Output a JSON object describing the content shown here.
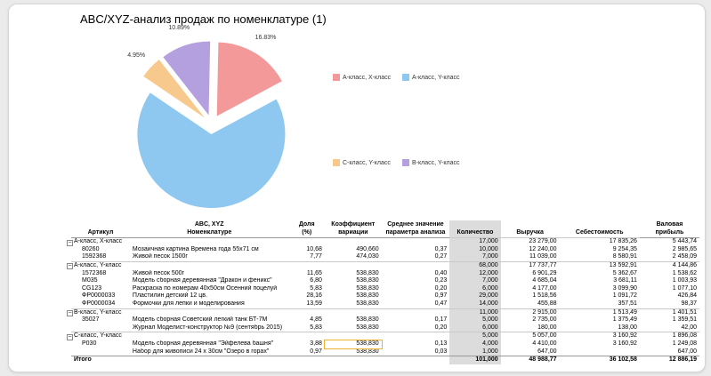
{
  "report": {
    "title": "ABC/XYZ-анализ продаж по номенклатуре (1)"
  },
  "chart_data": {
    "type": "pie",
    "slices": [
      {
        "label": "А-класс, Y-класс",
        "value": 67.33,
        "percent_label": "67.33%",
        "color": "#8ec8f0"
      },
      {
        "label": "А-класс, X-класс",
        "value": 16.83,
        "percent_label": "16.83%",
        "color": "#f4999a"
      },
      {
        "label": "B-класс, Y-класс",
        "value": 10.89,
        "percent_label": "10.89%",
        "color": "#b4a0de"
      },
      {
        "label": "С-класс, Y-класс",
        "value": 4.95,
        "percent_label": "4.95%",
        "color": "#f7c98c"
      }
    ],
    "legend": [
      {
        "label": "А-класс, X-класс",
        "color": "#f4999a"
      },
      {
        "label": "А-класс, Y-класс",
        "color": "#8ec8f0"
      },
      {
        "label": "С-класс, Y-класс",
        "color": "#f7c98c"
      },
      {
        "label": "B-класс, Y-класс",
        "color": "#b4a0de"
      }
    ]
  },
  "table": {
    "headers": {
      "article": "Артикул",
      "abc_xyz": "ABC, XYZ",
      "nomenclature": "Номенклатуре",
      "share_1": "Доля",
      "share_2": "(%)",
      "coef_1": "Коэффициент",
      "coef_2": "вариации",
      "avg_1": "Среднее значение",
      "avg_2": "параметра анализа",
      "qty": "Количество",
      "revenue": "Выручка",
      "cost": "Себестоимость",
      "profit_1": "Валовая",
      "profit_2": "прибыль"
    },
    "rows": [
      {
        "type": "group",
        "label": "А-класс, X-класс",
        "qty": "17,000",
        "revenue": "23 279,00",
        "cost": "17 835,26",
        "profit": "5 443,74"
      },
      {
        "type": "item",
        "article": "80260",
        "name": "Мозаичная картина Времена года 55х71 см",
        "share": "10,68",
        "coef": "490,660",
        "avg": "0,37",
        "qty": "10,000",
        "revenue": "12 240,00",
        "cost": "9 254,35",
        "profit": "2 985,65"
      },
      {
        "type": "item",
        "article": "1592368",
        "name": "Живой песок 1500г",
        "share": "7,77",
        "coef": "474,030",
        "avg": "0,27",
        "qty": "7,000",
        "revenue": "11 039,00",
        "cost": "8 580,91",
        "profit": "2 458,09"
      },
      {
        "type": "group",
        "label": "А-класс, Y-класс",
        "qty": "68,000",
        "revenue": "17 737,77",
        "cost": "13 592,91",
        "profit": "4 144,86"
      },
      {
        "type": "item",
        "article": "1572368",
        "name": "Живой песок 500г",
        "share": "11,65",
        "coef": "538,830",
        "avg": "0,40",
        "qty": "12,000",
        "revenue": "6 901,29",
        "cost": "5 362,67",
        "profit": "1 538,62"
      },
      {
        "type": "item",
        "article": "M035",
        "name": "Модель сборная деревянная \"Дракон и феникс\"",
        "share": "6,80",
        "coef": "538,830",
        "avg": "0,23",
        "qty": "7,000",
        "revenue": "4 685,04",
        "cost": "3 681,11",
        "profit": "1 003,93"
      },
      {
        "type": "item",
        "article": "CG123",
        "name": "Раскраска по номерам 40х50см Осенний поцелуй",
        "share": "5,83",
        "coef": "538,830",
        "avg": "0,20",
        "qty": "6,000",
        "revenue": "4 177,00",
        "cost": "3 099,90",
        "profit": "1 077,10"
      },
      {
        "type": "item",
        "article": "ФР0000033",
        "name": "Пластилин детский 12 цв.",
        "share": "28,16",
        "coef": "538,830",
        "avg": "0,97",
        "qty": "29,000",
        "revenue": "1 518,56",
        "cost": "1 091,72",
        "profit": "426,84"
      },
      {
        "type": "item",
        "article": "ФР0000034",
        "name": "Формочки для лепки и моделирования",
        "share": "13,59",
        "coef": "538,830",
        "avg": "0,47",
        "qty": "14,000",
        "revenue": "455,88",
        "cost": "357,51",
        "profit": "98,37"
      },
      {
        "type": "group",
        "label": "B-класс, Y-класс",
        "qty": "11,000",
        "revenue": "2 915,00",
        "cost": "1 513,49",
        "profit": "1 401,51"
      },
      {
        "type": "item",
        "article": "35027",
        "name": "Модель сборная Советский легкий танк БТ-7М",
        "share": "4,85",
        "coef": "538,830",
        "avg": "0,17",
        "qty": "5,000",
        "revenue": "2 735,00",
        "cost": "1 375,49",
        "profit": "1 359,51"
      },
      {
        "type": "item",
        "article": "",
        "name": "Журнал Моделист-конструктор №9 (сентябрь 2015)",
        "share": "5,83",
        "coef": "538,830",
        "avg": "0,20",
        "qty": "6,000",
        "revenue": "180,00",
        "cost": "138,00",
        "profit": "42,00"
      },
      {
        "type": "group",
        "label": "С-класс, Y-класс",
        "qty": "5,000",
        "revenue": "5 057,00",
        "cost": "3 160,92",
        "profit": "1 896,08"
      },
      {
        "type": "item",
        "article": "P030",
        "name": "Модель сборная деревянная \"Эйфелева башня\"",
        "share": "3,88",
        "coef": "538,830",
        "avg": "0,13",
        "qty": "4,000",
        "revenue": "4 410,00",
        "cost": "3 160,92",
        "profit": "1 249,08",
        "highlight": true
      },
      {
        "type": "item",
        "article": "",
        "name": "Набор для живописи 24 х 30см \"Озеро в горах\"",
        "share": "0,97",
        "coef": "538,830",
        "avg": "0,03",
        "qty": "1,000",
        "revenue": "647,00",
        "cost": "",
        "profit": "647,00"
      }
    ],
    "total": {
      "label": "Итого",
      "qty": "101,000",
      "revenue": "48 988,77",
      "cost": "36 102,58",
      "profit": "12 886,19"
    }
  }
}
